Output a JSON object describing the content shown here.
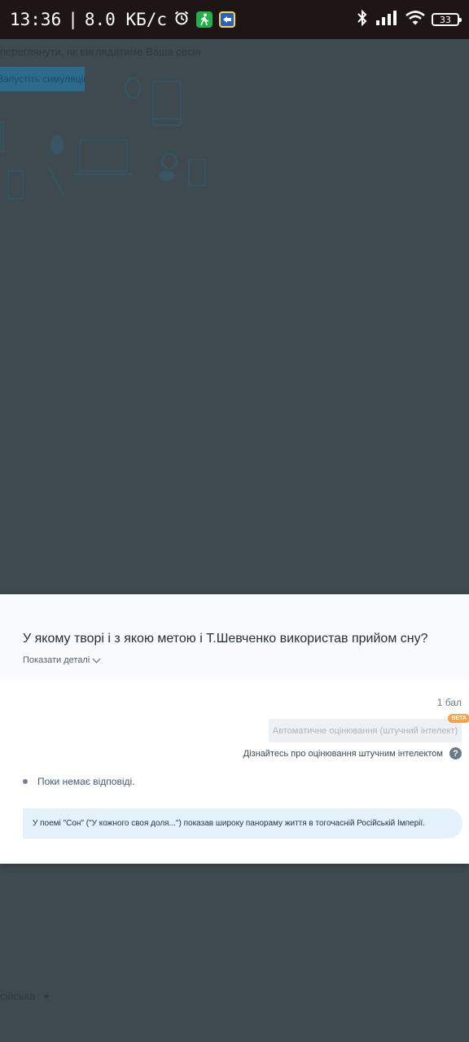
{
  "status_bar": {
    "time": "13:36",
    "separator": "|",
    "network_speed": "8.0 КБ/с",
    "battery": "33",
    "icons": [
      "alarm-icon",
      "walk-app-icon",
      "blue-yellow-app-icon",
      "bluetooth-icon",
      "signal-icon",
      "wifi-icon",
      "battery-icon"
    ]
  },
  "background": {
    "hint_text": "переглянути, як виглядатиме Ваша сесія",
    "button_label": "Запустіть симуляцію",
    "bottom_text": "сійська"
  },
  "modal": {
    "question": "У якому творі і з якою метою і Т.Шевченко використав прийом сну?",
    "show_details": "Показати деталі",
    "points": "1 бал",
    "auto_grading_button": "Автоматичне оцінювання (штучний інтелект)",
    "beta_badge": "BETA",
    "ai_info_link": "Дізнайтесь про оцінювання штучним інтелектом",
    "ai_info_icon": "?",
    "no_answer": "Поки немає відповіді.",
    "answer": "У поемі \"Сон\" (\"У кожного своя доля...\") показав широку панораму життя в тогочасній Російській Імперії."
  },
  "colors": {
    "overlay": "#3e4a50",
    "status_bar": "#1e1616",
    "answer_bg": "#e3f2fb",
    "beta": "#f3a34a"
  }
}
